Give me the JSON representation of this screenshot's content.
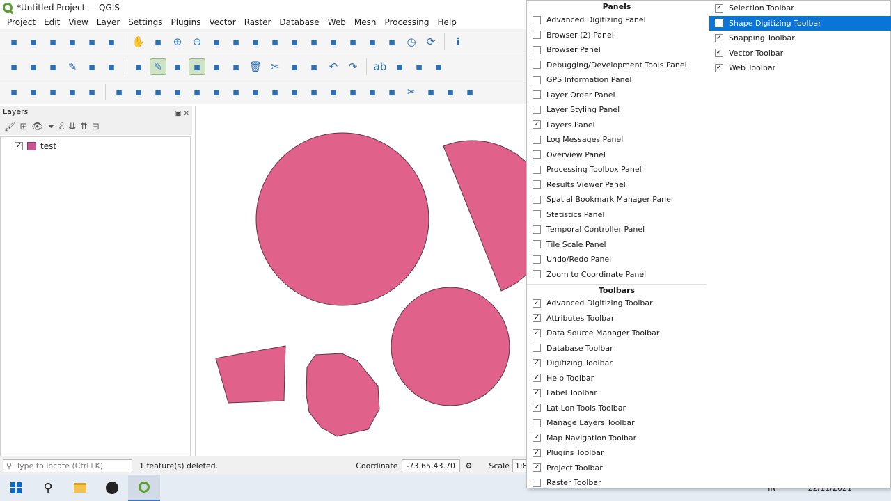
{
  "window": {
    "title": "*Untitled Project — QGIS"
  },
  "menu": [
    "Project",
    "Edit",
    "View",
    "Layer",
    "Settings",
    "Plugins",
    "Vector",
    "Raster",
    "Database",
    "Web",
    "Mesh",
    "Processing",
    "Help"
  ],
  "toolbar_rows": [
    [
      "new-project-icon",
      "open-project-icon",
      "save-project-icon",
      "save-as-icon",
      "print-layout-icon",
      "style-manager-icon",
      "|",
      "pan-icon",
      "pan-to-selection-icon",
      "zoom-in-icon",
      "zoom-out-icon",
      "zoom-full-icon",
      "zoom-selection-icon",
      "zoom-layer-icon",
      "zoom-native-icon",
      "zoom-last-icon",
      "zoom-next-icon",
      "new-map-view-icon",
      "new-3d-view-icon",
      "new-bookmark-icon",
      "show-bookmarks-icon",
      "temporal-controller-icon",
      "refresh-icon",
      "|",
      "identify-icon"
    ],
    [
      "data-source-manager-icon",
      "new-geopackage-icon",
      "vertex-tool-icon",
      "edit-pencil-icon",
      "digitize-icon",
      "virtual-layer-icon",
      "|",
      "current-edits-icon",
      "toggle-editing-icon",
      "save-edits-icon",
      "add-polygon-icon",
      "vertex-dropdown-icon",
      "modify-attributes-icon",
      "delete-selected-icon",
      "cut-features-icon",
      "copy-features-icon",
      "paste-features-icon",
      "undo-icon",
      "redo-icon",
      "|",
      "label-abc-icon",
      "diagram-icon",
      "pin-labels-icon",
      "label-remove-icon"
    ],
    [
      "select-features-icon",
      "select-dropdown-icon",
      "attribute-table-icon",
      "deselect-icon",
      "select-all-icon",
      "|",
      "measure-icon",
      "ruler-icon",
      "add-ring-icon",
      "reshape-icon",
      "offset-icon",
      "fill-ring-icon",
      "delete-ring-icon",
      "delete-part-icon",
      "rotate-icon",
      "simplify-icon",
      "add-part-icon",
      "merge-icon",
      "split-icon",
      "vertex-editor-icon",
      "split-parts-icon",
      "scissors-icon",
      "rotate-point-icon",
      "trim-extend-icon",
      "tracing-icon"
    ]
  ],
  "layers_panel": {
    "title": "Layers",
    "toolbar_icons": [
      "open-style-icon",
      "add-group-icon",
      "manage-map-themes-icon",
      "filter-legend-icon",
      "filter-expression-icon",
      "expand-all-icon",
      "collapse-all-icon",
      "remove-layer-icon"
    ],
    "layers": [
      {
        "name": "test",
        "checked": true
      }
    ]
  },
  "status": {
    "locate_placeholder": "Type to locate (Ctrl+K)",
    "message": "1 feature(s) deleted.",
    "coordinate_label": "Coordinate",
    "coordinate_value": "-73.65,43.70",
    "scale_label": "Scale",
    "scale_value": "1:8"
  },
  "popup": {
    "panels_header": "Panels",
    "panels": [
      {
        "label": "Advanced Digitizing Panel",
        "checked": false
      },
      {
        "label": "Browser (2) Panel",
        "checked": false
      },
      {
        "label": "Browser Panel",
        "checked": false
      },
      {
        "label": "Debugging/Development Tools Panel",
        "checked": false
      },
      {
        "label": "GPS Information Panel",
        "checked": false
      },
      {
        "label": "Layer Order Panel",
        "checked": false
      },
      {
        "label": "Layer Styling Panel",
        "checked": false
      },
      {
        "label": "Layers Panel",
        "checked": true
      },
      {
        "label": "Log Messages Panel",
        "checked": false
      },
      {
        "label": "Overview Panel",
        "checked": false
      },
      {
        "label": "Processing Toolbox Panel",
        "checked": false
      },
      {
        "label": "Results Viewer Panel",
        "checked": false
      },
      {
        "label": "Spatial Bookmark Manager Panel",
        "checked": false
      },
      {
        "label": "Statistics Panel",
        "checked": false
      },
      {
        "label": "Temporal Controller Panel",
        "checked": false
      },
      {
        "label": "Tile Scale Panel",
        "checked": false
      },
      {
        "label": "Undo/Redo Panel",
        "checked": false
      },
      {
        "label": "Zoom to Coordinate Panel",
        "checked": false
      }
    ],
    "toolbars_header": "Toolbars",
    "toolbars": [
      {
        "label": "Advanced Digitizing Toolbar",
        "checked": true
      },
      {
        "label": "Attributes Toolbar",
        "checked": true
      },
      {
        "label": "Data Source Manager Toolbar",
        "checked": true
      },
      {
        "label": "Database Toolbar",
        "checked": false
      },
      {
        "label": "Digitizing Toolbar",
        "checked": true
      },
      {
        "label": "Help Toolbar",
        "checked": true
      },
      {
        "label": "Label Toolbar",
        "checked": true
      },
      {
        "label": "Lat Lon Tools Toolbar",
        "checked": true
      },
      {
        "label": "Manage Layers Toolbar",
        "checked": false
      },
      {
        "label": "Map Navigation Toolbar",
        "checked": true
      },
      {
        "label": "Plugins Toolbar",
        "checked": true
      },
      {
        "label": "Project Toolbar",
        "checked": true
      },
      {
        "label": "Raster Toolbar",
        "checked": false
      }
    ],
    "toolbars_col2": [
      {
        "label": "Selection Toolbar",
        "checked": true,
        "highlighted": false
      },
      {
        "label": "Shape Digitizing Toolbar",
        "checked": false,
        "highlighted": true
      },
      {
        "label": "Snapping Toolbar",
        "checked": true,
        "highlighted": false
      },
      {
        "label": "Vector Toolbar",
        "checked": true,
        "highlighted": false
      },
      {
        "label": "Web Toolbar",
        "checked": true,
        "highlighted": false
      }
    ]
  },
  "taskbar": {
    "apps": [
      "windows-start-icon",
      "search-icon",
      "file-explorer-icon",
      "obs-icon",
      "qgis-icon"
    ],
    "lang": "IN",
    "date": "22/11/2021"
  },
  "colors": {
    "feature_fill": "#e0628a",
    "feature_stroke": "#5a3548",
    "highlight": "#0a74d8"
  }
}
